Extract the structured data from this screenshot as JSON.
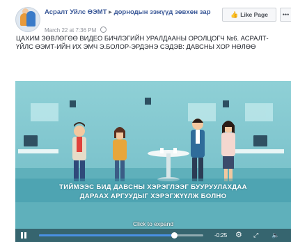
{
  "post": {
    "page_name": "Асралт Уйлс ӨЭМТ",
    "arrow": "▸",
    "group_name": "дорнодын зэжүүд зөвхөн зар",
    "timestamp": "March 22 at 7:36 PM",
    "like_page_label": "Like Page",
    "more_label": "•••",
    "caption": "ЦАХИМ ЗӨВЛӨГӨӨ ВИДЕО БИЧЛЭГИЙН УРАЛДААНЫ ОРОЛЦОГЧ №6. АСРАЛТ-ҮЙЛС ӨЭМТ-ИЙН ИХ ЭМЧ Э.БОЛОР-ЭРДЭНЭ СЭДЭВ: ДАВСНЫ ХОР НӨЛӨӨ"
  },
  "video": {
    "overlay_line1": "ТИЙМЭЭС БИД ДАВСНЫ ХЭРЭГЛЭЭГ БУУРУУЛАХДАА",
    "overlay_line2": "ДАРААХ АРГУУДЫГ ХЭРЭГЖҮҮЛЖ БОЛНО",
    "click_to_expand": "Click to expand",
    "time_remaining": "-0:25",
    "progress": 0.82
  },
  "icons": {
    "pause": "pause-icon",
    "settings": "gear-icon",
    "fullscreen": "fullscreen-icon",
    "volume": "volume-icon",
    "like": "thumbs-up-icon",
    "globe": "globe-icon"
  },
  "colors": {
    "link": "#3b5998",
    "video_bg": "#7cc3cc",
    "progress": "#4a90e2"
  }
}
